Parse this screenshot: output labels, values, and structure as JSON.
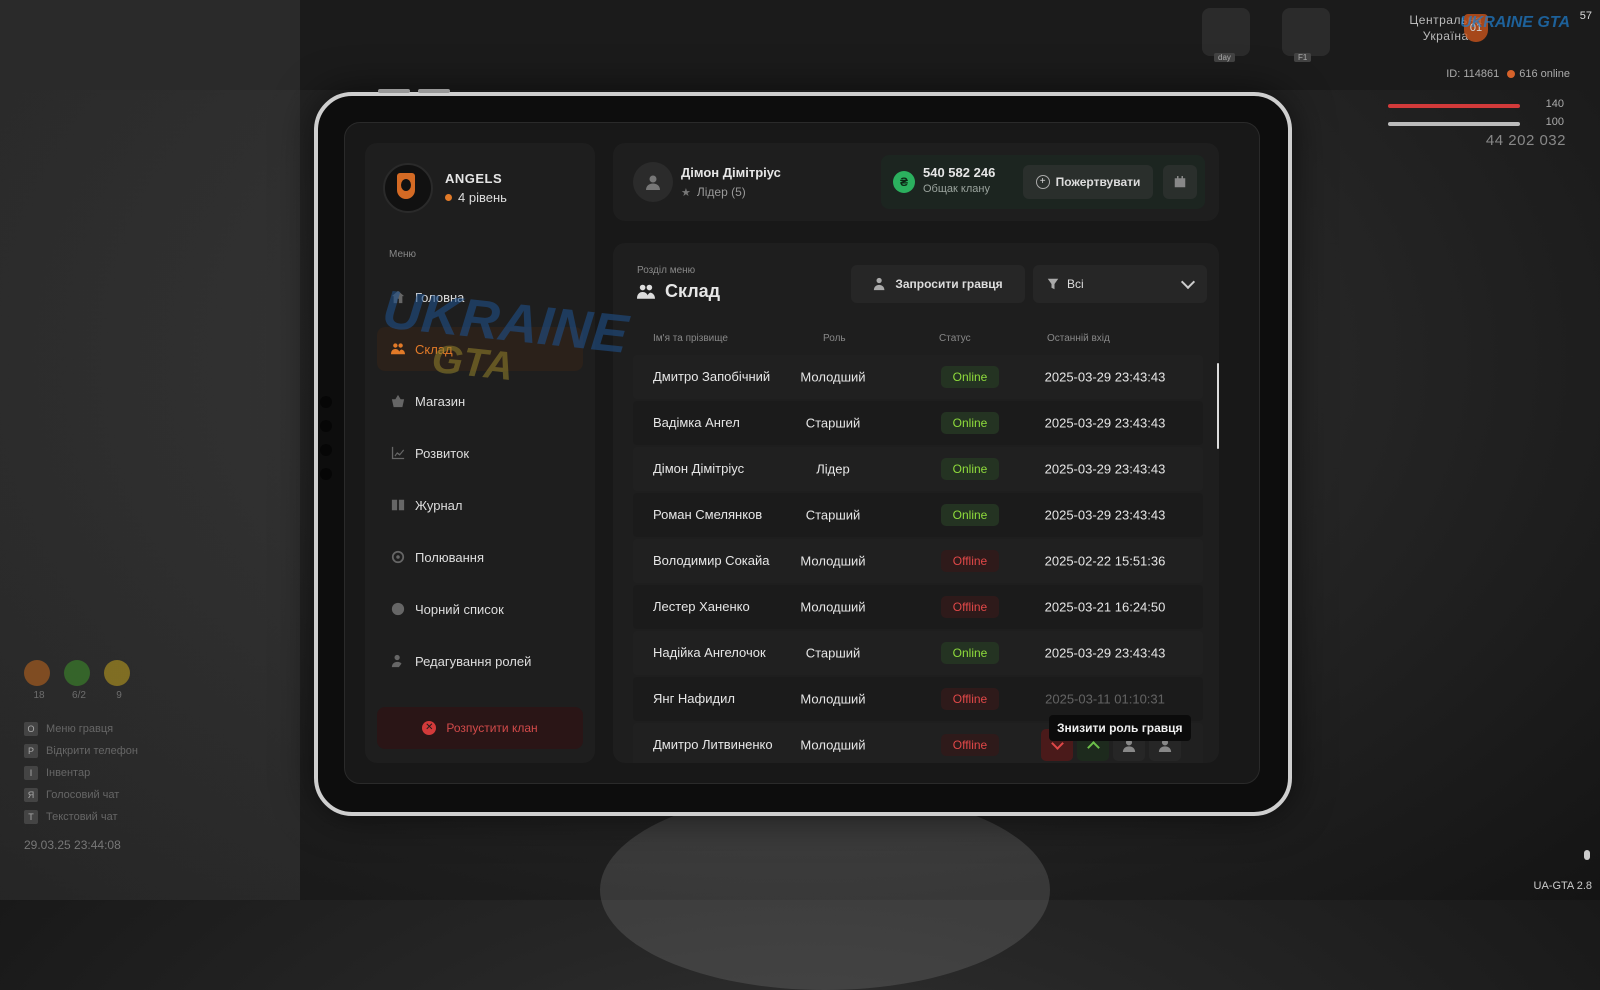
{
  "hud": {
    "fps": "57",
    "region_line1": "Центральна",
    "region_line2": "Україна",
    "region_badge": "01",
    "server_logo": "UKRAINE GTA",
    "icon1_label": "day",
    "icon2_label": "F1",
    "player_id": "ID: 114861",
    "online": "616 online",
    "health": "140",
    "armor": "100",
    "money": "44 202 032",
    "stats": [
      "18",
      "6/2",
      "9"
    ],
    "keybinds": [
      {
        "key": "O",
        "label": "Меню гравця"
      },
      {
        "key": "P",
        "label": "Відкрити телефон"
      },
      {
        "key": "I",
        "label": "Інвентар"
      },
      {
        "key": "Я",
        "label": "Голосовий чат"
      },
      {
        "key": "T",
        "label": "Текстовий чат"
      }
    ],
    "datetime": "29.03.25 23:44:08",
    "version": "UA-GTA 2.8"
  },
  "sidebar": {
    "clan_name": "ANGELS",
    "clan_level": "4 рівень",
    "menu_title": "Меню",
    "items": [
      {
        "label": "Головна",
        "icon": "home-icon"
      },
      {
        "label": "Склад",
        "icon": "people-icon",
        "active": true
      },
      {
        "label": "Магазин",
        "icon": "basket-icon"
      },
      {
        "label": "Розвиток",
        "icon": "chart-icon"
      },
      {
        "label": "Журнал",
        "icon": "book-icon"
      },
      {
        "label": "Полювання",
        "icon": "target-icon"
      },
      {
        "label": "Чорний список",
        "icon": "block-icon"
      },
      {
        "label": "Редагування ролей",
        "icon": "user-edit-icon"
      }
    ],
    "disband_label": "Розпустити клан"
  },
  "header": {
    "user_name": "Дімон Дімітріус",
    "user_role": "Лідер (5)",
    "balance": "540 582 246",
    "balance_label": "Общак клану",
    "donate_label": "Пожертвувати"
  },
  "main": {
    "section_label": "Розділ меню",
    "section_title": "Склад",
    "invite_label": "Запросити гравця",
    "filter_value": "Всі",
    "columns": [
      "Ім'я та прізвище",
      "Роль",
      "Статус",
      "Останній вхід"
    ],
    "rows": [
      {
        "name": "Дмитро Запобічний",
        "role": "Молодший",
        "status": "Online",
        "last": "2025-03-29 23:43:43"
      },
      {
        "name": "Вадімка Ангел",
        "role": "Старший",
        "status": "Online",
        "last": "2025-03-29 23:43:43"
      },
      {
        "name": "Дімон Дімітріус",
        "role": "Лідер",
        "status": "Online",
        "last": "2025-03-29 23:43:43"
      },
      {
        "name": "Роман Смелянков",
        "role": "Старший",
        "status": "Online",
        "last": "2025-03-29 23:43:43"
      },
      {
        "name": "Володимир Сокайа",
        "role": "Молодший",
        "status": "Offline",
        "last": "2025-02-22 15:51:36"
      },
      {
        "name": "Лестер Ханенко",
        "role": "Молодший",
        "status": "Offline",
        "last": "2025-03-21 16:24:50"
      },
      {
        "name": "Надійка Ангелочок",
        "role": "Старший",
        "status": "Online",
        "last": "2025-03-29 23:43:43"
      },
      {
        "name": "Янг Нафидил",
        "role": "Молодший",
        "status": "Offline",
        "last": "2025-03-11 01:10:31"
      },
      {
        "name": "Дмитро Литвиненко",
        "role": "Молодший",
        "status": "Offline",
        "last": ""
      }
    ],
    "tooltip": "Знизити роль гравця"
  },
  "watermark": {
    "line1": "UKRAINE",
    "line2": "GTA"
  },
  "colors": {
    "accent": "#e27a28",
    "online": "#8fdc3c",
    "offline": "#e04848",
    "balance": "#2bb05e"
  }
}
